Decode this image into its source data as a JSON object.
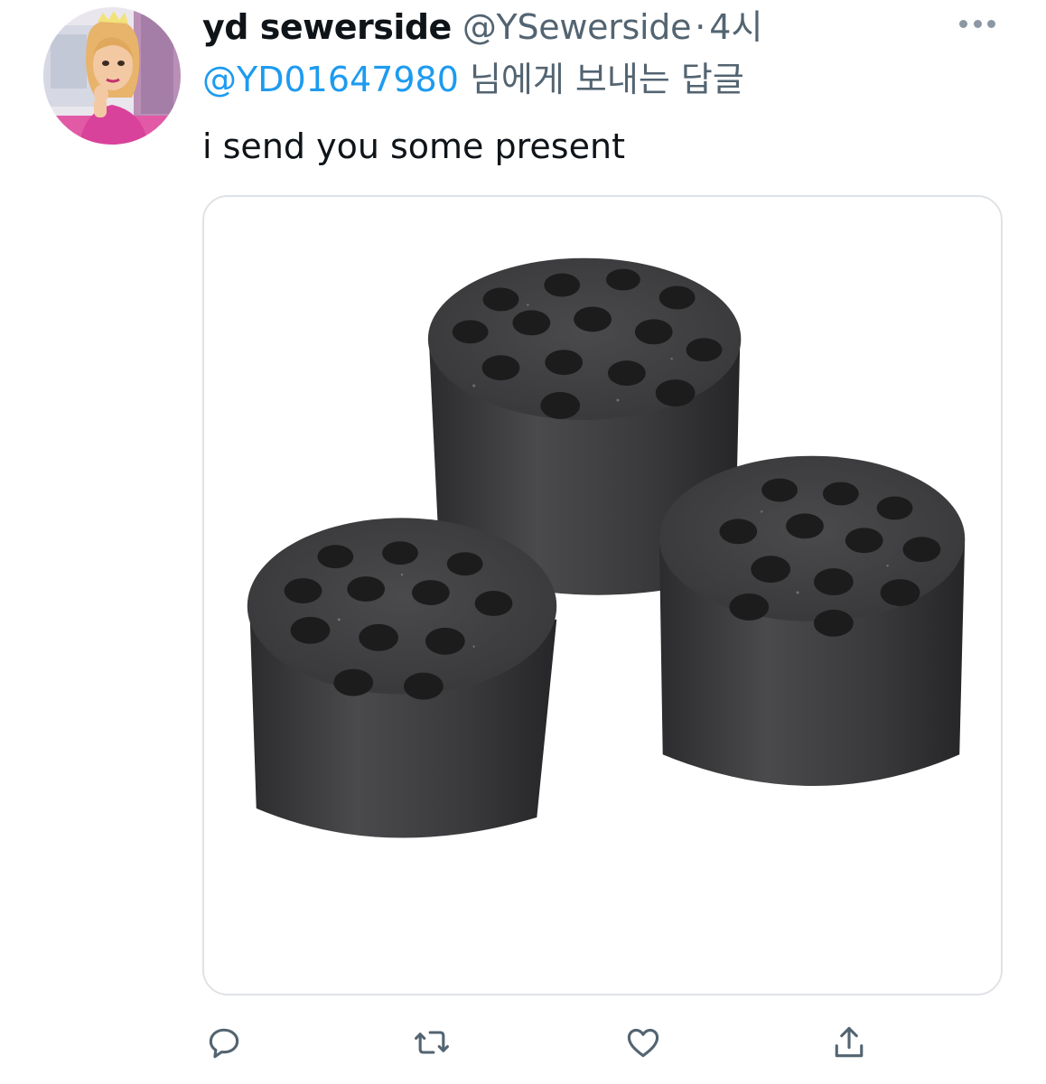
{
  "tweet": {
    "display_name": "yd sewerside",
    "handle": "@YSewerside",
    "separator": "·",
    "time": "4시",
    "reply_to_mention": "@YD01647980",
    "reply_to_suffix": " 님에게 보내는 답글",
    "text": "i send you some present"
  },
  "media": {
    "icon": "charcoal-briquettes-photo"
  },
  "actions": [
    {
      "name": "reply",
      "icon": "speech-bubble-icon"
    },
    {
      "name": "retweet",
      "icon": "retweet-arrows-icon"
    },
    {
      "name": "like",
      "icon": "heart-icon"
    },
    {
      "name": "share",
      "icon": "share-upload-icon"
    }
  ],
  "colors": {
    "accent": "#1d9bf0",
    "secondary_text": "#536471",
    "primary_text": "#0f1419",
    "border": "#dfe3e6",
    "icon_gray": "#536471"
  }
}
